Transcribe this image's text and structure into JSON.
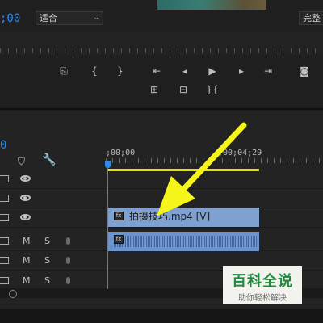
{
  "monitor": {
    "timecode": ";00",
    "fit_label": "适合",
    "quality_label": "完整",
    "transport": [
      {
        "name": "export-frame-icon",
        "glyph": "⎘"
      },
      {
        "name": "mark-in-icon",
        "glyph": "{"
      },
      {
        "name": "mark-out-icon",
        "glyph": "}"
      },
      {
        "name": "go-to-in-icon",
        "glyph": "⇤"
      },
      {
        "name": "step-back-icon",
        "glyph": "◂"
      },
      {
        "name": "play-icon",
        "glyph": "▶"
      },
      {
        "name": "step-forward-icon",
        "glyph": "▸"
      },
      {
        "name": "go-to-out-icon",
        "glyph": "⇥"
      },
      {
        "name": "camera-icon",
        "glyph": "◙"
      },
      {
        "name": "lift-icon",
        "glyph": "⊞"
      },
      {
        "name": "extract-icon",
        "glyph": "⊟"
      },
      {
        "name": "trim-icon",
        "glyph": "}{"
      }
    ]
  },
  "timeline": {
    "timecode": "0",
    "ruler_start": ";00;00",
    "ruler_mid": ";00;04;29",
    "video_tracks": [
      {
        "eye": "visible"
      },
      {
        "eye": "visible"
      },
      {
        "eye": "visible"
      }
    ],
    "audio_tracks": [
      {
        "mute": "M",
        "solo": "S"
      },
      {
        "mute": "M",
        "solo": "S"
      },
      {
        "mute": "M",
        "solo": "S"
      }
    ],
    "clip_label": "拍摄技巧.mp4 [V]",
    "clip_fx": "fx"
  },
  "watermark": {
    "title": "百科全说",
    "subtitle": "助你轻松解决"
  },
  "colors": {
    "accent": "#2d8ceb",
    "work_area": "#e6e600",
    "video_clip": "#7fa1d2",
    "audio_clip": "#6d93cc",
    "arrow": "#f5f51a"
  }
}
